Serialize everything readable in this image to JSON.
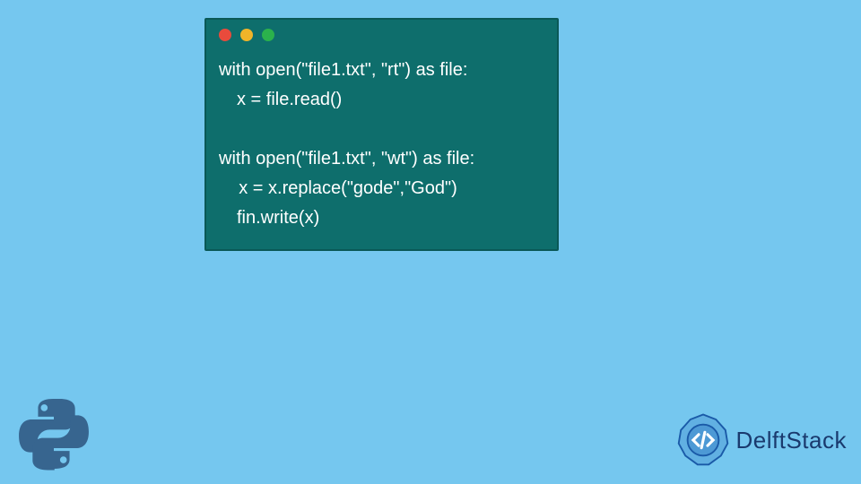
{
  "code": {
    "lines": [
      "with open(\"file1.txt\", \"rt\") as file:",
      "　x = file.read()",
      "　",
      "with open(\"file1.txt\", \"wt\") as file:",
      "    x = x.replace(\"gode\",\"God\")",
      "　fin.write(x)"
    ]
  },
  "colors": {
    "bg": "#75c7ef",
    "window": "#0e6e6c",
    "dot_red": "#e94b3c",
    "dot_yellow": "#f0b429",
    "dot_green": "#2bb24c"
  },
  "brand": {
    "name": "DelftStack"
  },
  "icons": {
    "python": "python-logo",
    "delft": "delftstack-logo"
  }
}
